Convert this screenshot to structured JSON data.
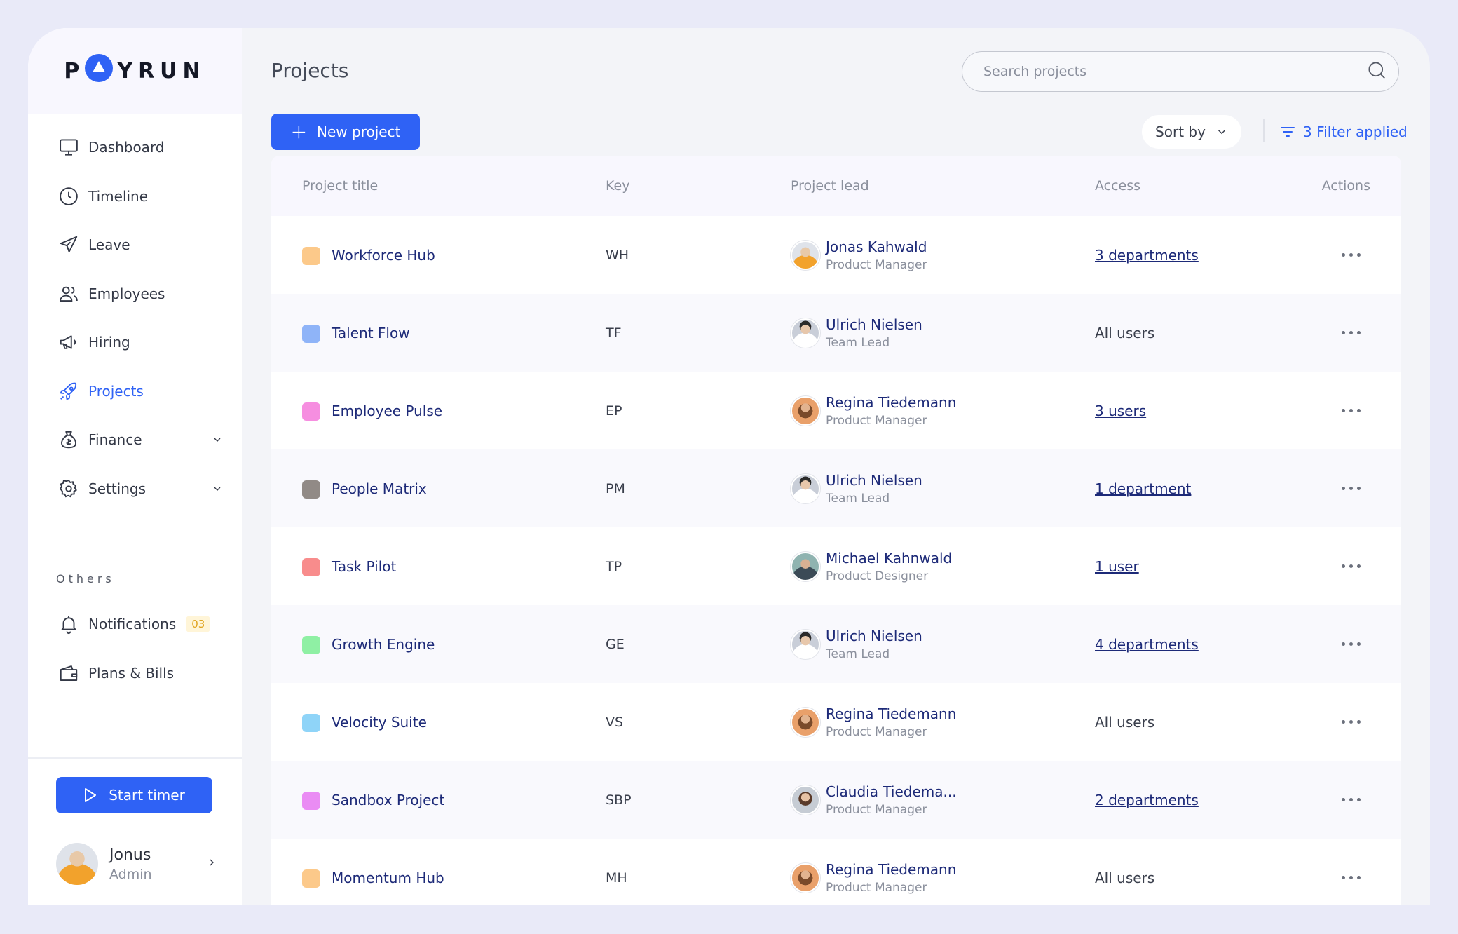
{
  "app": {
    "logo": "PAYRUN"
  },
  "sidebar": {
    "items": [
      {
        "label": "Dashboard",
        "icon": "monitor-icon"
      },
      {
        "label": "Timeline",
        "icon": "clock-icon"
      },
      {
        "label": "Leave",
        "icon": "plane-icon"
      },
      {
        "label": "Employees",
        "icon": "users-icon"
      },
      {
        "label": "Hiring",
        "icon": "megaphone-icon"
      },
      {
        "label": "Projects",
        "icon": "rocket-icon",
        "active": true
      },
      {
        "label": "Finance",
        "icon": "money-bag-icon",
        "expandable": true
      },
      {
        "label": "Settings",
        "icon": "gear-icon",
        "expandable": true
      }
    ],
    "others_label": "Others",
    "others": [
      {
        "label": "Notifications",
        "icon": "bell-icon",
        "badge": "03"
      },
      {
        "label": "Plans & Bills",
        "icon": "wallet-icon"
      }
    ],
    "start_timer": "Start timer",
    "user": {
      "name": "Jonus",
      "role": "Admin"
    }
  },
  "main": {
    "title": "Projects",
    "search_placeholder": "Search projects",
    "new_project": "New project",
    "sort_by": "Sort by",
    "filter": "3 Filter applied",
    "accent": "#2f62f5"
  },
  "table": {
    "headers": {
      "title": "Project title",
      "key": "Key",
      "lead": "Project lead",
      "access": "Access",
      "actions": "Actions"
    },
    "rows": [
      {
        "title": "Workforce Hub",
        "color": "#fcc98a",
        "key": "WH",
        "lead": "Jonas Kahwald",
        "role": "Product Manager",
        "access": "3 departments",
        "link": true,
        "face": "a"
      },
      {
        "title": "Talent Flow",
        "color": "#8fb4f8",
        "key": "TF",
        "lead": "Ulrich Nielsen",
        "role": "Team Lead",
        "access": "All users",
        "link": false,
        "face": "b"
      },
      {
        "title": "Employee Pulse",
        "color": "#f68ee0",
        "key": "EP",
        "lead": "Regina Tiedemann",
        "role": "Product Manager",
        "access": "3 users",
        "link": true,
        "face": "c"
      },
      {
        "title": "People Matrix",
        "color": "#918a86",
        "key": "PM",
        "lead": "Ulrich Nielsen",
        "role": "Team Lead",
        "access": "1 department",
        "link": true,
        "face": "b"
      },
      {
        "title": "Task Pilot",
        "color": "#f88c8c",
        "key": "TP",
        "lead": "Michael Kahnwald",
        "role": "Product Designer",
        "access": "1 user",
        "link": true,
        "face": "d"
      },
      {
        "title": "Growth Engine",
        "color": "#8ff0a4",
        "key": "GE",
        "lead": "Ulrich Nielsen",
        "role": "Team Lead",
        "access": "4 departments",
        "link": true,
        "face": "b"
      },
      {
        "title": "Velocity Suite",
        "color": "#8fd4f8",
        "key": "VS",
        "lead": "Regina Tiedemann",
        "role": "Product Manager",
        "access": "All users",
        "link": false,
        "face": "c"
      },
      {
        "title": "Sandbox Project",
        "color": "#ea8cf4",
        "key": "SBP",
        "lead": "Claudia Tiedema...",
        "role": "Product Manager",
        "access": "2 departments",
        "link": true,
        "face": "e"
      },
      {
        "title": "Momentum Hub",
        "color": "#fcc98a",
        "key": "MH",
        "lead": "Regina Tiedemann",
        "role": "Product Manager",
        "access": "All users",
        "link": false,
        "face": "c"
      }
    ]
  }
}
